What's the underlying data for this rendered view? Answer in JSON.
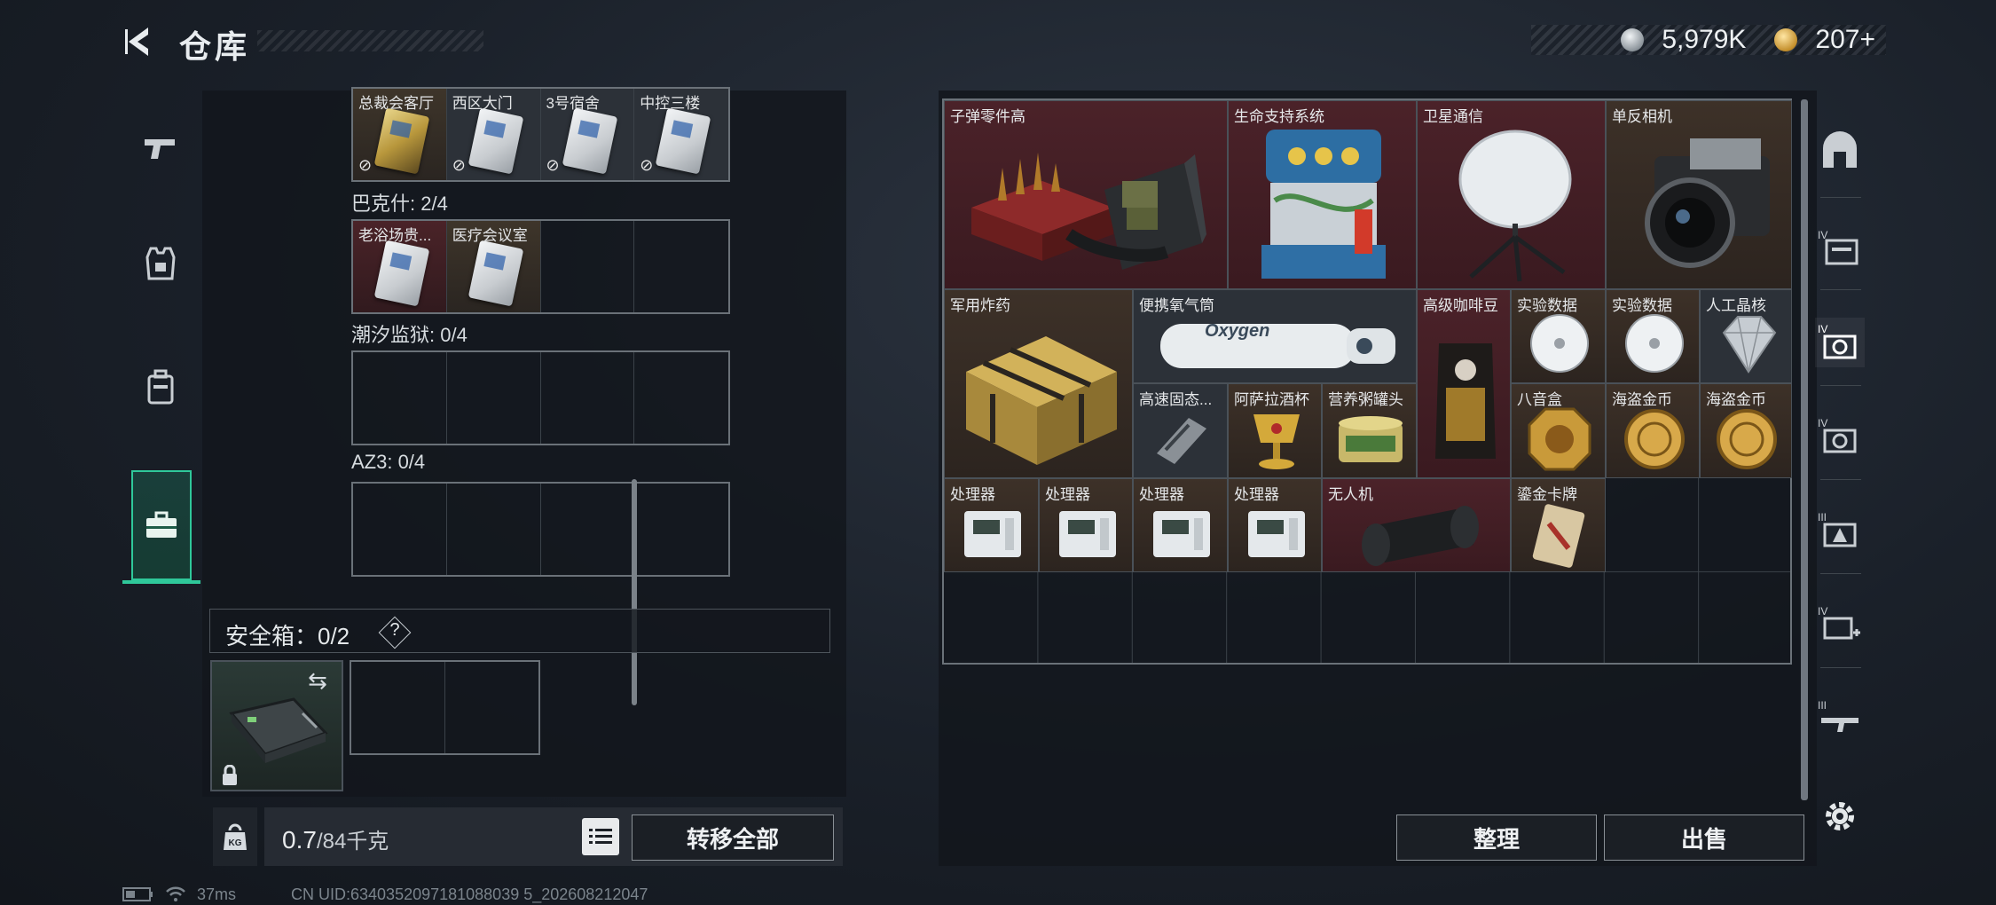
{
  "header": {
    "title": "仓库",
    "currency": [
      {
        "icon": "silver-coin-icon",
        "value": "5,979K",
        "color": "#c9cfd4"
      },
      {
        "icon": "gold-coin-icon",
        "value": "207",
        "suffix": "+",
        "color": "#d8a94a"
      }
    ]
  },
  "left_nav": [
    {
      "icon": "pistol-icon",
      "active": false
    },
    {
      "icon": "armor-vest-icon",
      "active": false
    },
    {
      "icon": "backpack-icon",
      "active": false
    },
    {
      "icon": "toolbox-icon",
      "active": true
    }
  ],
  "key_sections": [
    {
      "label": "",
      "slots": [
        {
          "name": "总裁会客厅",
          "card": "gold",
          "unusable": true
        },
        {
          "name": "西区大门",
          "card": "silver",
          "unusable": true
        },
        {
          "name": "3号宿舍",
          "card": "silver",
          "unusable": true
        },
        {
          "name": "中控三楼",
          "card": "silver",
          "unusable": true
        }
      ]
    },
    {
      "label": "巴克什: 2/4",
      "slots": [
        {
          "name": "老浴场贵...",
          "card": "silver"
        },
        {
          "name": "医疗会议室",
          "card": "silver"
        },
        {},
        {}
      ]
    },
    {
      "label": "潮汐监狱: 0/4",
      "slots": [
        {},
        {},
        {},
        {}
      ]
    },
    {
      "label": "AZ3: 0/4",
      "slots": [
        {},
        {},
        {},
        {}
      ]
    }
  ],
  "safe_box": {
    "label": "安全箱：0/2",
    "help": "?",
    "swap_icon": "swap-arrows-icon",
    "lock_icon": "lock-icon"
  },
  "weight": {
    "unit_icon": "KG",
    "current": "0.7",
    "max": "/84千克"
  },
  "buttons": {
    "transfer_all": "转移全部",
    "sort": "整理",
    "sell": "出售"
  },
  "warehouse_items": {
    "ammo_parts": "子弹零件高",
    "life_support": "生命支持系统",
    "sat_comm": "卫星通信",
    "slr_camera": "单反相机",
    "explosive": "军用炸药",
    "oxygen": "便携氧气筒",
    "oxygen_label": "Oxygen",
    "coffee": "高级咖啡豆",
    "data1": "实验数据",
    "data2": "实验数据",
    "diamond": "人工晶核",
    "solid_state": "高速固态...",
    "chalice": "阿萨拉酒杯",
    "canned": "营养粥罐头",
    "bagua": "八音盒",
    "coin1": "海盗金币",
    "coin2": "海盗金币",
    "cpu1": "处理器",
    "cpu2": "处理器",
    "cpu3": "处理器",
    "cpu4": "处理器",
    "drone": "无人机",
    "gold_card": "鎏金卡牌"
  },
  "right_nav": [
    "vault-icon",
    "tier4-container-icon",
    "tier4-camera-icon",
    "tier4-camera-alt-icon",
    "tier3-warning-icon",
    "tier4-medkit-icon",
    "tier3-rifle-icon",
    "settings-gear-icon"
  ],
  "status": {
    "ping": "37ms",
    "uid": "CN UID:6340352097181088039 5_202608212047"
  }
}
